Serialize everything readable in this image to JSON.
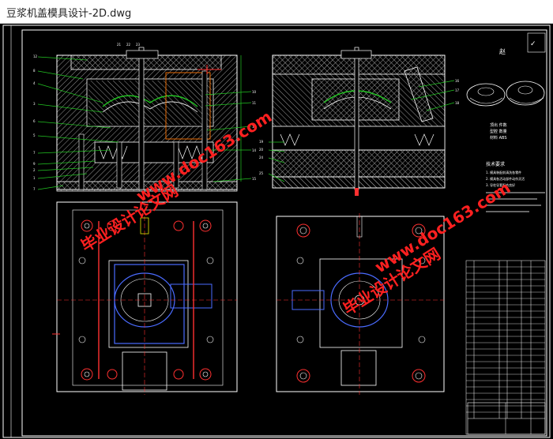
{
  "window": {
    "title": "豆浆机盖模具设计-2D.dwg"
  },
  "drawing": {
    "tech_title": "技术要求",
    "tech_lines": [
      "1. 模具装配前清洗各零件",
      "2. 模具各活动部件动作灵活",
      "3. 导柱导套配合良好"
    ],
    "tag": "赵",
    "small_notes": [
      "顶出 件数",
      "型腔 数量",
      "材料 ABS"
    ]
  },
  "watermark": {
    "site": "www.doc163.com",
    "cn": "毕业设计论文网"
  },
  "colors": {
    "frame": "#ffffff",
    "hatch": "#bdbdbd",
    "green": "#22c522",
    "red": "#ff3030",
    "blue": "#4a6bff",
    "yellow": "#e8e800",
    "cyan": "#00d0e0",
    "watermark": "#ff2020"
  }
}
